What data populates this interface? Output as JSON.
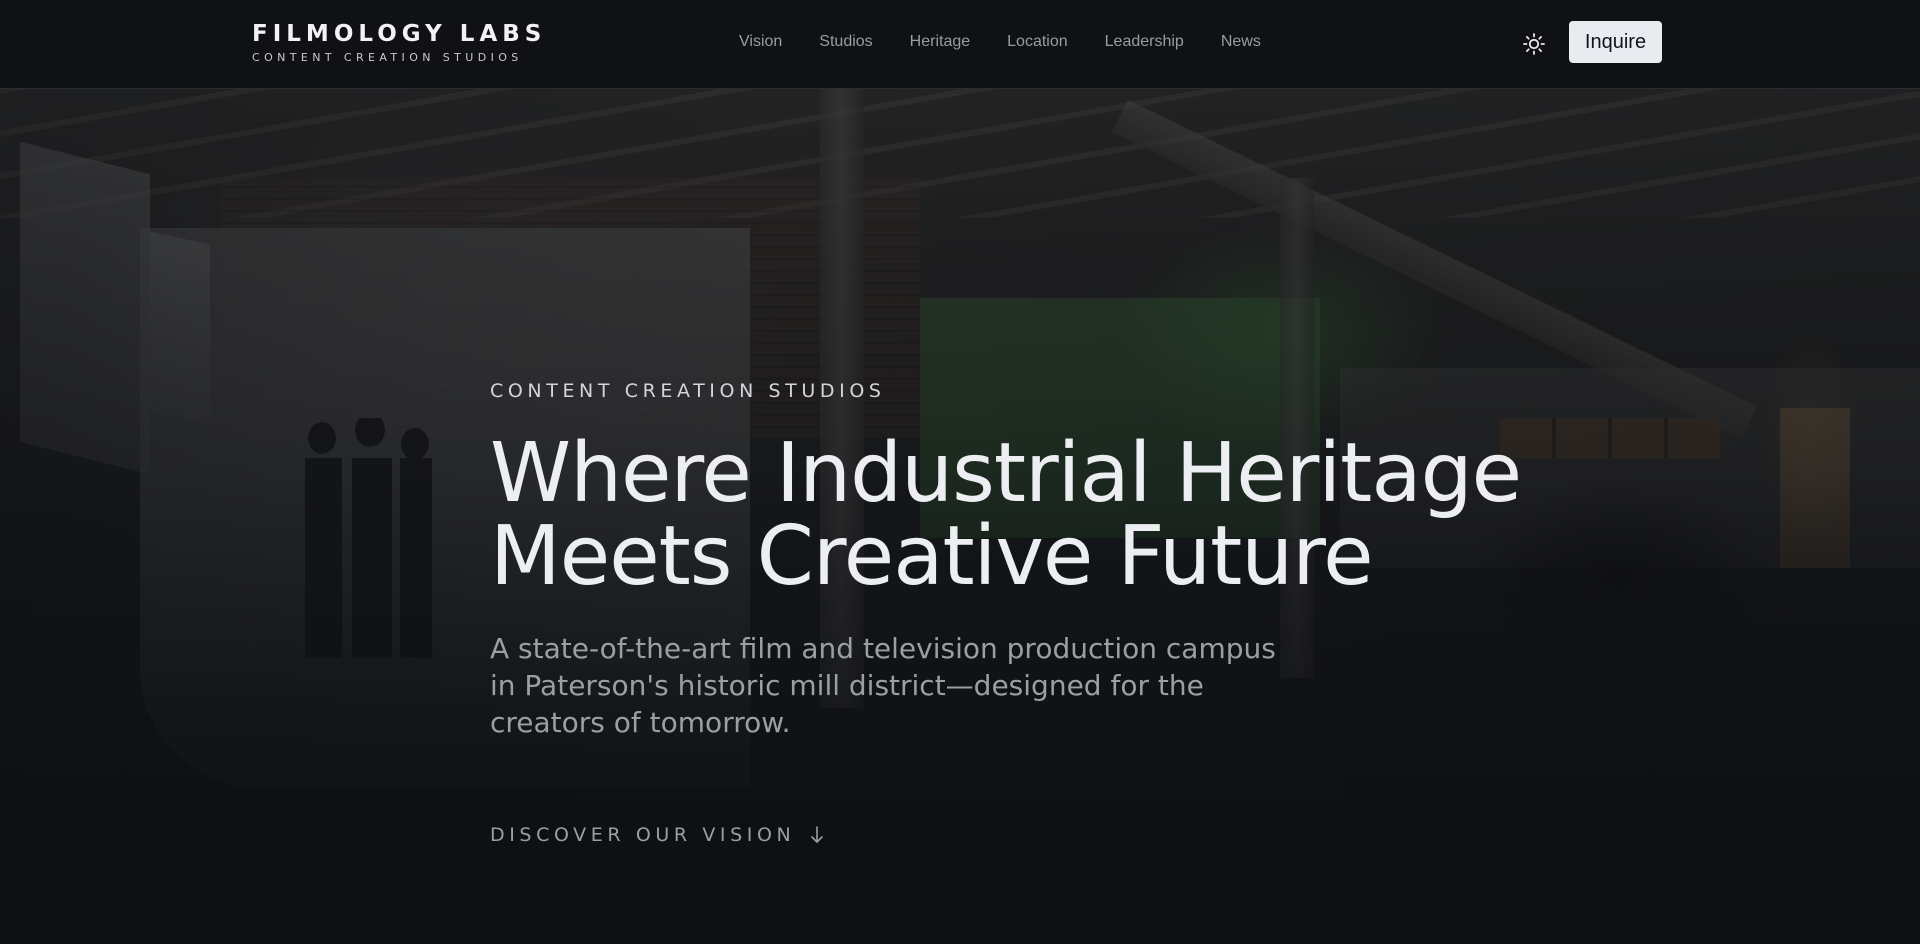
{
  "brand": {
    "name": "FILMOLOGY LABS",
    "tagline": "CONTENT CREATION STUDIOS"
  },
  "nav": {
    "items": [
      {
        "label": "Vision"
      },
      {
        "label": "Studios"
      },
      {
        "label": "Heritage"
      },
      {
        "label": "Location"
      },
      {
        "label": "Leadership"
      },
      {
        "label": "News"
      }
    ]
  },
  "header": {
    "theme_toggle_icon": "sun-icon",
    "inquire_label": "Inquire"
  },
  "hero": {
    "eyebrow": "CONTENT CREATION STUDIOS",
    "headline_line1": "Where Industrial Heritage",
    "headline_line2": "Meets Creative Future",
    "subcopy": "A state-of-the-art film and television production campus in Paterson's historic mill district—designed for the creators of tomorrow.",
    "cta_label": "DISCOVER OUR VISION",
    "cta_icon": "arrow-down-icon",
    "background_image": "film-studio-interior"
  },
  "colors": {
    "background": "#0e1014",
    "header_bg": "#0f1115",
    "button_bg": "#e8ecf1",
    "nav_text": "#9a9ca3",
    "headline": "#eceef1"
  }
}
